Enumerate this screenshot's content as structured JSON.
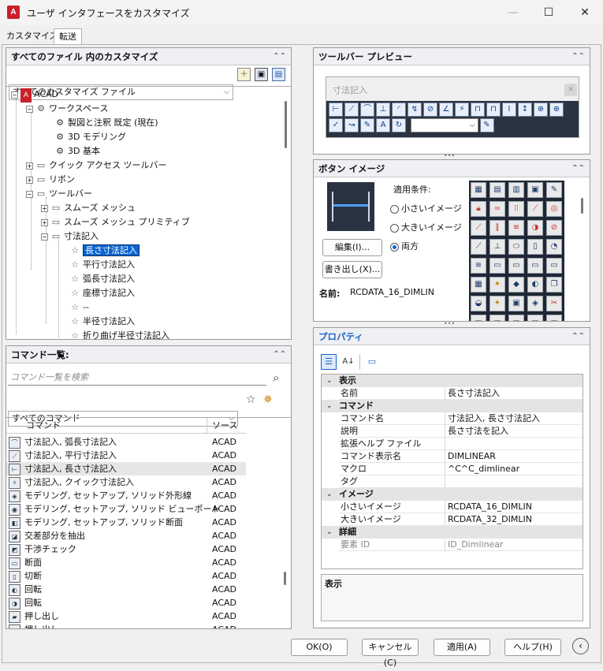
{
  "window": {
    "title": "ユーザ インタフェースをカスタマイズ",
    "app_icon_label": "A",
    "controls": {
      "minimize": "—",
      "maximize": "☐",
      "close": "✕"
    }
  },
  "tabs": [
    {
      "label": "カスタマイズ"
    },
    {
      "label": "転送"
    }
  ],
  "customize_panel": {
    "title": "すべてのファイル 内のカスタマイズ",
    "file_select": "すべてのカスタマイズ ファイル",
    "tree": [
      {
        "label": "ACAD",
        "icon": "acad-icon"
      },
      {
        "label": "ワークスペース",
        "icon": "gear-icon"
      },
      {
        "label": "製図と注釈 既定 (現在)",
        "icon": "gear-icon"
      },
      {
        "label": "3D モデリング",
        "icon": "gear-icon"
      },
      {
        "label": "3D 基本",
        "icon": "gear-icon"
      },
      {
        "label": "クイック アクセス ツールバー",
        "icon": "toolbar-icon"
      },
      {
        "label": "リボン",
        "icon": "ribbon-icon"
      },
      {
        "label": "ツールバー",
        "icon": "toolbar-icon"
      },
      {
        "label": "スムーズ メッシュ",
        "icon": "toolbar-icon"
      },
      {
        "label": "スムーズ メッシュ プリミティブ",
        "icon": "toolbar-icon"
      },
      {
        "label": "寸法記入",
        "icon": "toolbar-icon"
      },
      {
        "label": "長さ寸法記入",
        "icon": "star-icon"
      },
      {
        "label": "平行寸法記入",
        "icon": "star-icon"
      },
      {
        "label": "弧長寸法記入",
        "icon": "star-icon"
      },
      {
        "label": "座標寸法記入",
        "icon": "star-icon"
      },
      {
        "label": "--",
        "icon": "star-icon"
      },
      {
        "label": "半径寸法記入",
        "icon": "star-icon"
      },
      {
        "label": "折り曲げ半径寸法記入",
        "icon": "star-icon"
      }
    ]
  },
  "command_panel": {
    "title": "コマンド一覧:",
    "search_placeholder": "コマンド一覧を検索",
    "filter_select": "すべてのコマンド",
    "columns": {
      "command": "コマンド",
      "source": "ソース"
    },
    "rows": [
      {
        "command": "寸法記入, 弧長寸法記入",
        "source": "ACAD"
      },
      {
        "command": "寸法記入, 平行寸法記入",
        "source": "ACAD"
      },
      {
        "command": "寸法記入, 長さ寸法記入",
        "source": "ACAD"
      },
      {
        "command": "寸法記入, クイック寸法記入",
        "source": "ACAD"
      },
      {
        "command": "モデリング, セットアップ, ソリッド外形線",
        "source": "ACAD"
      },
      {
        "command": "モデリング, セットアップ, ソリッド ビューポート",
        "source": "ACAD"
      },
      {
        "command": "モデリング, セットアップ, ソリッド断面",
        "source": "ACAD"
      },
      {
        "command": "交差部分を抽出",
        "source": "ACAD"
      },
      {
        "command": "干渉チェック",
        "source": "ACAD"
      },
      {
        "command": "断面",
        "source": "ACAD"
      },
      {
        "command": "切断",
        "source": "ACAD"
      },
      {
        "command": "回転",
        "source": "ACAD"
      },
      {
        "command": "回転",
        "source": "ACAD"
      },
      {
        "command": "押し出し",
        "source": "ACAD"
      },
      {
        "command": "押し出し",
        "source": "ACAD"
      }
    ]
  },
  "toolbar_preview": {
    "title": "ツールバー プレビュー",
    "toolbar_name": "寸法記入",
    "close_label": "✕"
  },
  "button_image": {
    "title": "ボタン イメージ",
    "apply_label": "適用条件:",
    "radio_small": "小さいイメージ",
    "radio_large": "大きいイメージ",
    "radio_both": "両方",
    "edit_button": "編集(I)...",
    "export_button": "書き出し(X)...",
    "name_label": "名前:",
    "name_value": "RCDATA_16_DIMLIN"
  },
  "properties": {
    "title": "プロパティ",
    "categories": [
      {
        "name": "表示",
        "rows": [
          {
            "key": "名前",
            "value": "長さ寸法記入"
          }
        ]
      },
      {
        "name": "コマンド",
        "rows": [
          {
            "key": "コマンド名",
            "value": "寸法記入, 長さ寸法記入"
          },
          {
            "key": "説明",
            "value": "長さ寸法を記入"
          },
          {
            "key": "拡張ヘルプ ファイル",
            "value": ""
          },
          {
            "key": "コマンド表示名",
            "value": "DIMLINEAR"
          },
          {
            "key": "マクロ",
            "value": "^C^C_dimlinear"
          },
          {
            "key": "タグ",
            "value": ""
          }
        ]
      },
      {
        "name": "イメージ",
        "rows": [
          {
            "key": "小さいイメージ",
            "value": "RCDATA_16_DIMLIN"
          },
          {
            "key": "大きいイメージ",
            "value": "RCDATA_32_DIMLIN"
          }
        ]
      },
      {
        "name": "詳細",
        "rows": [
          {
            "key": "要素 ID",
            "value": "ID_Dimlinear"
          }
        ]
      }
    ],
    "description_label": "表示"
  },
  "footer": {
    "ok": "OK(O)",
    "cancel": "キャンセル(C)",
    "apply": "適用(A)",
    "help": "ヘルプ(H)"
  }
}
